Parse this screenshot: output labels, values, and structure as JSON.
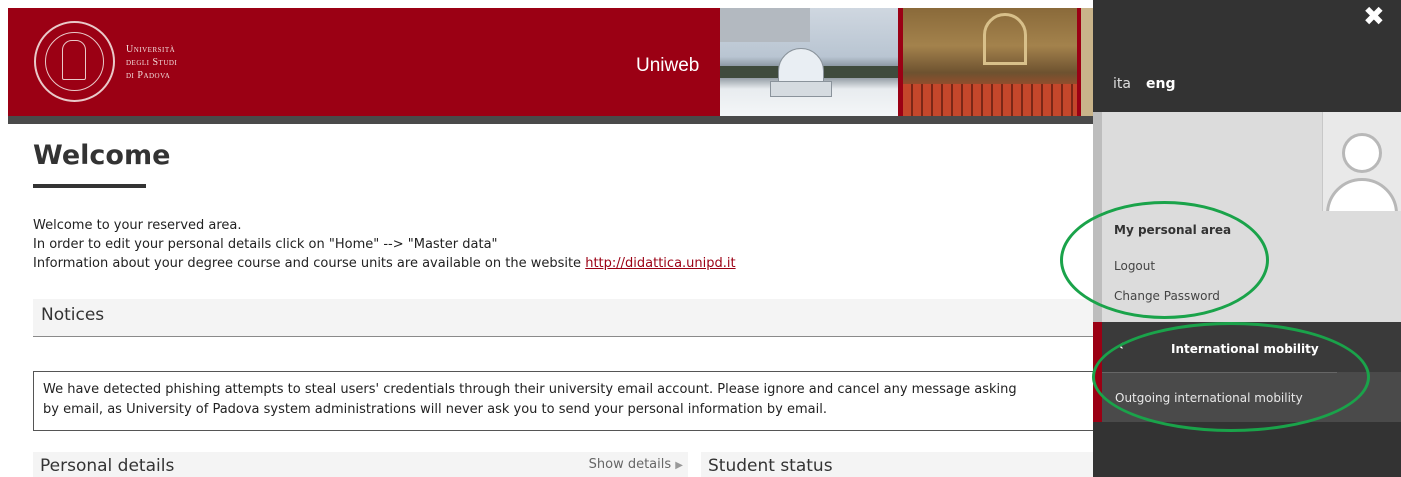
{
  "header": {
    "university_name_lines": [
      "Università",
      "degli Studi",
      "di Padova"
    ],
    "app_title": "Uniweb"
  },
  "main": {
    "welcome_title": "Welcome",
    "intro_lines": [
      "Welcome to your reserved area.",
      "In order to edit your personal details click on \"Home\" --> \"Master data\"",
      "Information about your degree course and course units are available on the website "
    ],
    "intro_link": "http://didattica.unipd.it",
    "notices_title": "Notices",
    "notice_lines": [
      "We have detected phishing attempts to steal users' credentials through their university email account. Please ignore and cancel any message asking",
      "by email, as University of Padova system administrations will never ask you to send your personal information by email."
    ],
    "personal_details_title": "Personal details",
    "show_details_label": "Show details",
    "show_details_icon": "triangle-right-icon",
    "student_status_title": "Student status"
  },
  "side_panel": {
    "close_icon": "close-icon",
    "languages": [
      "ita",
      "eng"
    ],
    "active_language": "eng",
    "avatar_icon": "user-avatar-icon",
    "personal_area_title": "My personal area",
    "logout_label": "Logout",
    "change_password_label": "Change Password",
    "section_title": "International mobility",
    "section_back_icon": "chevron-left-icon",
    "section_items": [
      "Outgoing international mobility"
    ]
  },
  "colors": {
    "brand_red": "#9b0014",
    "panel_dark": "#333333",
    "annotation_green": "#1aa34a"
  }
}
